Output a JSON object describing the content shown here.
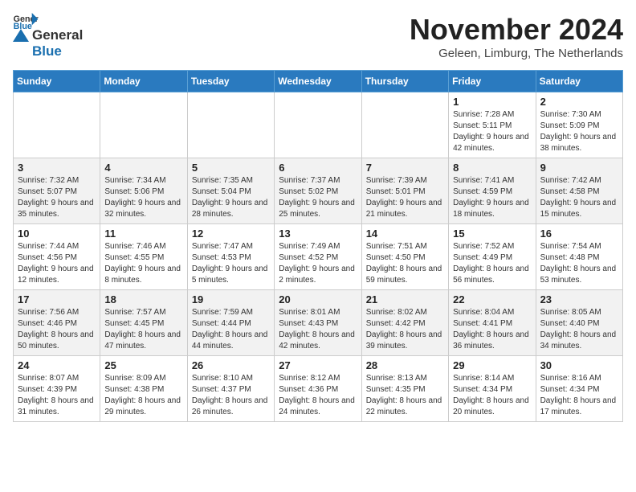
{
  "logo": {
    "general": "General",
    "blue": "Blue"
  },
  "title": "November 2024",
  "subtitle": "Geleen, Limburg, The Netherlands",
  "days_of_week": [
    "Sunday",
    "Monday",
    "Tuesday",
    "Wednesday",
    "Thursday",
    "Friday",
    "Saturday"
  ],
  "weeks": [
    [
      {
        "day": "",
        "info": ""
      },
      {
        "day": "",
        "info": ""
      },
      {
        "day": "",
        "info": ""
      },
      {
        "day": "",
        "info": ""
      },
      {
        "day": "",
        "info": ""
      },
      {
        "day": "1",
        "info": "Sunrise: 7:28 AM\nSunset: 5:11 PM\nDaylight: 9 hours and 42 minutes."
      },
      {
        "day": "2",
        "info": "Sunrise: 7:30 AM\nSunset: 5:09 PM\nDaylight: 9 hours and 38 minutes."
      }
    ],
    [
      {
        "day": "3",
        "info": "Sunrise: 7:32 AM\nSunset: 5:07 PM\nDaylight: 9 hours and 35 minutes."
      },
      {
        "day": "4",
        "info": "Sunrise: 7:34 AM\nSunset: 5:06 PM\nDaylight: 9 hours and 32 minutes."
      },
      {
        "day": "5",
        "info": "Sunrise: 7:35 AM\nSunset: 5:04 PM\nDaylight: 9 hours and 28 minutes."
      },
      {
        "day": "6",
        "info": "Sunrise: 7:37 AM\nSunset: 5:02 PM\nDaylight: 9 hours and 25 minutes."
      },
      {
        "day": "7",
        "info": "Sunrise: 7:39 AM\nSunset: 5:01 PM\nDaylight: 9 hours and 21 minutes."
      },
      {
        "day": "8",
        "info": "Sunrise: 7:41 AM\nSunset: 4:59 PM\nDaylight: 9 hours and 18 minutes."
      },
      {
        "day": "9",
        "info": "Sunrise: 7:42 AM\nSunset: 4:58 PM\nDaylight: 9 hours and 15 minutes."
      }
    ],
    [
      {
        "day": "10",
        "info": "Sunrise: 7:44 AM\nSunset: 4:56 PM\nDaylight: 9 hours and 12 minutes."
      },
      {
        "day": "11",
        "info": "Sunrise: 7:46 AM\nSunset: 4:55 PM\nDaylight: 9 hours and 8 minutes."
      },
      {
        "day": "12",
        "info": "Sunrise: 7:47 AM\nSunset: 4:53 PM\nDaylight: 9 hours and 5 minutes."
      },
      {
        "day": "13",
        "info": "Sunrise: 7:49 AM\nSunset: 4:52 PM\nDaylight: 9 hours and 2 minutes."
      },
      {
        "day": "14",
        "info": "Sunrise: 7:51 AM\nSunset: 4:50 PM\nDaylight: 8 hours and 59 minutes."
      },
      {
        "day": "15",
        "info": "Sunrise: 7:52 AM\nSunset: 4:49 PM\nDaylight: 8 hours and 56 minutes."
      },
      {
        "day": "16",
        "info": "Sunrise: 7:54 AM\nSunset: 4:48 PM\nDaylight: 8 hours and 53 minutes."
      }
    ],
    [
      {
        "day": "17",
        "info": "Sunrise: 7:56 AM\nSunset: 4:46 PM\nDaylight: 8 hours and 50 minutes."
      },
      {
        "day": "18",
        "info": "Sunrise: 7:57 AM\nSunset: 4:45 PM\nDaylight: 8 hours and 47 minutes."
      },
      {
        "day": "19",
        "info": "Sunrise: 7:59 AM\nSunset: 4:44 PM\nDaylight: 8 hours and 44 minutes."
      },
      {
        "day": "20",
        "info": "Sunrise: 8:01 AM\nSunset: 4:43 PM\nDaylight: 8 hours and 42 minutes."
      },
      {
        "day": "21",
        "info": "Sunrise: 8:02 AM\nSunset: 4:42 PM\nDaylight: 8 hours and 39 minutes."
      },
      {
        "day": "22",
        "info": "Sunrise: 8:04 AM\nSunset: 4:41 PM\nDaylight: 8 hours and 36 minutes."
      },
      {
        "day": "23",
        "info": "Sunrise: 8:05 AM\nSunset: 4:40 PM\nDaylight: 8 hours and 34 minutes."
      }
    ],
    [
      {
        "day": "24",
        "info": "Sunrise: 8:07 AM\nSunset: 4:39 PM\nDaylight: 8 hours and 31 minutes."
      },
      {
        "day": "25",
        "info": "Sunrise: 8:09 AM\nSunset: 4:38 PM\nDaylight: 8 hours and 29 minutes."
      },
      {
        "day": "26",
        "info": "Sunrise: 8:10 AM\nSunset: 4:37 PM\nDaylight: 8 hours and 26 minutes."
      },
      {
        "day": "27",
        "info": "Sunrise: 8:12 AM\nSunset: 4:36 PM\nDaylight: 8 hours and 24 minutes."
      },
      {
        "day": "28",
        "info": "Sunrise: 8:13 AM\nSunset: 4:35 PM\nDaylight: 8 hours and 22 minutes."
      },
      {
        "day": "29",
        "info": "Sunrise: 8:14 AM\nSunset: 4:34 PM\nDaylight: 8 hours and 20 minutes."
      },
      {
        "day": "30",
        "info": "Sunrise: 8:16 AM\nSunset: 4:34 PM\nDaylight: 8 hours and 17 minutes."
      }
    ]
  ]
}
